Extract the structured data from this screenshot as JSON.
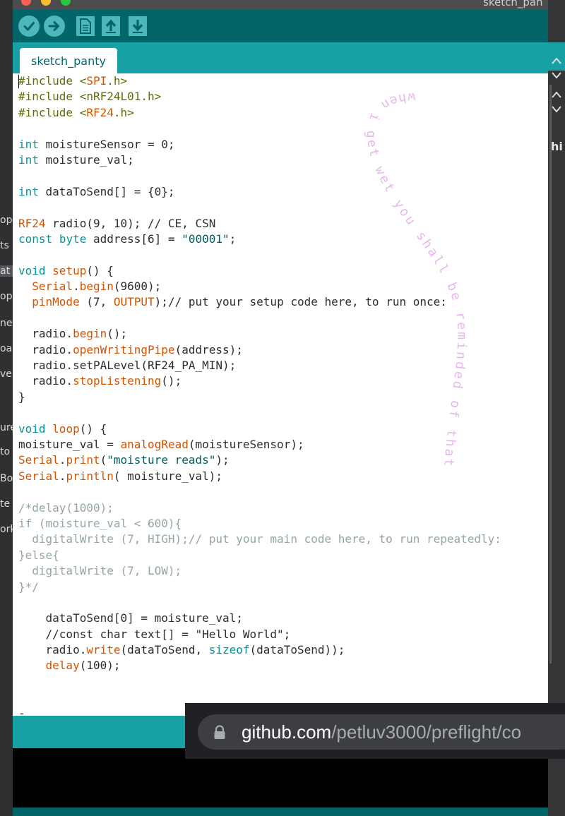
{
  "window": {
    "title": "sketch_pan"
  },
  "toolbar": {
    "buttons": [
      {
        "name": "verify",
        "icon": "checkmark-icon"
      },
      {
        "name": "upload",
        "icon": "arrow-right-icon"
      },
      {
        "name": "new",
        "icon": "document-icon"
      },
      {
        "name": "open",
        "icon": "arrow-up-icon"
      },
      {
        "name": "save",
        "icon": "arrow-down-icon"
      }
    ]
  },
  "tabs": [
    {
      "label": "sketch_panty",
      "active": true
    }
  ],
  "editor": {
    "lines": [
      [
        [
          "pp",
          "#include <"
        ],
        [
          "f",
          "SPI"
        ],
        [
          "pp",
          ".h>"
        ]
      ],
      [
        [
          "pp",
          "#include <nRF24L01.h>"
        ]
      ],
      [
        [
          "pp",
          "#include <"
        ],
        [
          "f",
          "RF24"
        ],
        [
          "pp",
          ".h>"
        ]
      ],
      [],
      [
        [
          "k",
          "int"
        ],
        [
          "n",
          " moistureSensor = 0;"
        ]
      ],
      [
        [
          "k",
          "int"
        ],
        [
          "n",
          " moisture_val;"
        ]
      ],
      [],
      [
        [
          "k",
          "int"
        ],
        [
          "n",
          " dataToSend[] = {0};"
        ]
      ],
      [],
      [
        [
          "f",
          "RF24"
        ],
        [
          "n",
          " radio(9, 10); // CE, CSN"
        ]
      ],
      [
        [
          "k",
          "const"
        ],
        [
          "n",
          " "
        ],
        [
          "k",
          "byte"
        ],
        [
          "n",
          " address[6] = "
        ],
        [
          "s",
          "\"00001\""
        ],
        [
          "n",
          ";"
        ]
      ],
      [],
      [
        [
          "k",
          "void"
        ],
        [
          "n",
          " "
        ],
        [
          "f",
          "setup"
        ],
        [
          "n",
          "() {"
        ]
      ],
      [
        [
          "n",
          "  "
        ],
        [
          "f",
          "Serial"
        ],
        [
          "n",
          "."
        ],
        [
          "f",
          "begin"
        ],
        [
          "n",
          "(9600);"
        ]
      ],
      [
        [
          "n",
          "  "
        ],
        [
          "f",
          "pinMode"
        ],
        [
          "n",
          " (7, "
        ],
        [
          "f",
          "OUTPUT"
        ],
        [
          "n",
          ");// put your setup code here, to run once:"
        ]
      ],
      [],
      [
        [
          "n",
          "  radio."
        ],
        [
          "f",
          "begin"
        ],
        [
          "n",
          "();"
        ]
      ],
      [
        [
          "n",
          "  radio."
        ],
        [
          "f",
          "openWritingPipe"
        ],
        [
          "n",
          "(address);"
        ]
      ],
      [
        [
          "n",
          "  radio.setPALevel(RF24_PA_MIN);"
        ]
      ],
      [
        [
          "n",
          "  radio."
        ],
        [
          "f",
          "stopListening"
        ],
        [
          "n",
          "();"
        ]
      ],
      [
        [
          "n",
          "}"
        ]
      ],
      [],
      [
        [
          "k",
          "void"
        ],
        [
          "n",
          " "
        ],
        [
          "f",
          "loop"
        ],
        [
          "n",
          "() {"
        ]
      ],
      [
        [
          "n",
          "moisture_val = "
        ],
        [
          "f",
          "analogRead"
        ],
        [
          "n",
          "(moistureSensor);"
        ]
      ],
      [
        [
          "f",
          "Serial"
        ],
        [
          "n",
          "."
        ],
        [
          "f",
          "print"
        ],
        [
          "n",
          "("
        ],
        [
          "s",
          "\"moisture reads\""
        ],
        [
          "n",
          ");"
        ]
      ],
      [
        [
          "f",
          "Serial"
        ],
        [
          "n",
          "."
        ],
        [
          "f",
          "println"
        ],
        [
          "n",
          "( moisture_val);"
        ]
      ],
      [],
      [
        [
          "c",
          "/*delay(1000);"
        ]
      ],
      [
        [
          "c",
          "if (moisture_val < 600){"
        ]
      ],
      [
        [
          "c",
          "  digitalWrite (7, HIGH);// put your main code here, to run repeatedly:"
        ]
      ],
      [
        [
          "c",
          "}else{"
        ]
      ],
      [
        [
          "c",
          "  digitalWrite (7, LOW);"
        ]
      ],
      [
        [
          "c",
          "}*/"
        ]
      ],
      [],
      [
        [
          "n",
          "    dataToSend[0] = moisture_val;"
        ]
      ],
      [
        [
          "n",
          "    //const char text[] = \"Hello World\";"
        ]
      ],
      [
        [
          "n",
          "    radio."
        ],
        [
          "f",
          "write"
        ],
        [
          "n",
          "(dataToSend, "
        ],
        [
          "k",
          "sizeof"
        ],
        [
          "n",
          "(dataToSend));"
        ]
      ],
      [
        [
          "n",
          "    "
        ],
        [
          "f",
          "delay"
        ],
        [
          "n",
          "(100);"
        ]
      ],
      [],
      [],
      [
        [
          "n",
          "-"
        ]
      ]
    ]
  },
  "handwriting": {
    "text": "when i get wet you shall be reminded of that",
    "color": "#e7b7ec"
  },
  "background": {
    "left_fragments": [
      "op",
      "ts",
      "at",
      "op",
      "ne",
      "oa",
      "ve",
      "ure",
      "to",
      "Bot",
      "te",
      "ork"
    ],
    "right_fragment": "hi"
  },
  "url_overlay": {
    "host": "github.com",
    "path": "/petluv3000/preflight/co",
    "lock_icon": "lock-icon"
  },
  "colors": {
    "toolbar": "#006468",
    "tabbar": "#17a1a5",
    "keyword": "#00979c",
    "function": "#d35400",
    "preprocessor": "#5e6d03",
    "comment": "#95a5a6"
  }
}
